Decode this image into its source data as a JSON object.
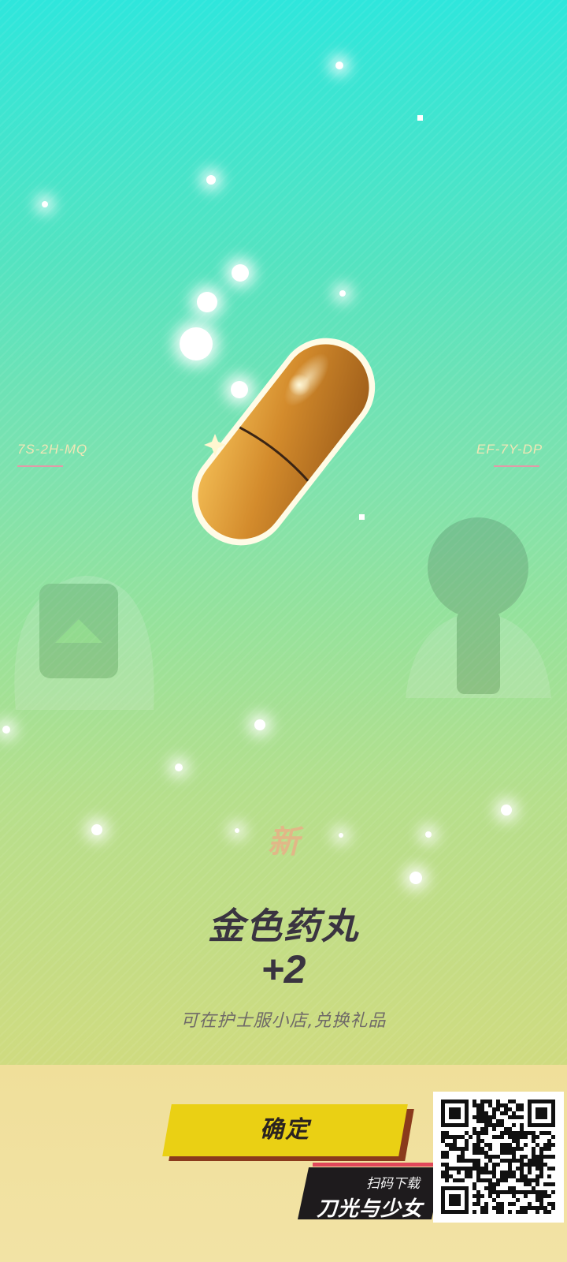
{
  "reward": {
    "new_tag": "新",
    "item_name": "金色药丸",
    "quantity": "+2",
    "description": "可在护士服小店,兑换礼品"
  },
  "codes": {
    "left": "7S-2H-MQ",
    "right": "EF-7Y-DP"
  },
  "confirm_button": {
    "label": "确定"
  },
  "promo": {
    "subtitle": "扫码下载",
    "title": "刀光与少女"
  },
  "colors": {
    "bg_top": "#2ee6dc",
    "bg_bottom": "#cfdb80",
    "button": "#ead014",
    "button_shadow": "#8a3a1c",
    "capsule": "#d38b2c",
    "text_dark": "#3a3440"
  },
  "icons": {
    "item": "golden-pill-capsule-icon",
    "qr": "qr-code-icon"
  }
}
